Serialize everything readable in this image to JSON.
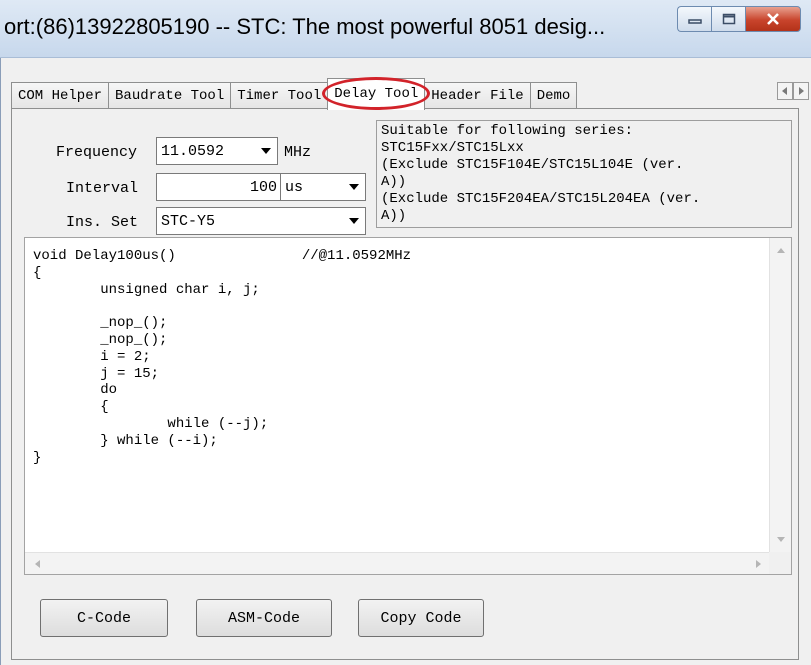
{
  "window": {
    "title": "ort:(86)13922805190  -- STC: The most powerful 8051 desig..."
  },
  "tabs": [
    {
      "label": "COM Helper"
    },
    {
      "label": "Baudrate Tool"
    },
    {
      "label": "Timer Tool"
    },
    {
      "label": "Delay Tool"
    },
    {
      "label": "Header File"
    },
    {
      "label": "Demo"
    }
  ],
  "active_tab": "Delay Tool",
  "highlight_color": "#d2232a",
  "settings": {
    "frequency_label": "Frequency",
    "frequency_value": "11.0592",
    "frequency_unit": "MHz",
    "interval_label": "Interval",
    "interval_value": "100",
    "interval_unit": "us",
    "ins_set_label": "Ins. Set",
    "ins_set_value": "STC-Y5"
  },
  "series_info": {
    "lines": [
      "Suitable for following series:",
      "STC15Fxx/STC15Lxx",
      " (Exclude STC15F104E/STC15L104E (ver.",
      "A))",
      " (Exclude STC15F204EA/STC15L204EA (ver.",
      "A))"
    ]
  },
  "code": {
    "lines": [
      "void Delay100us()\t\t//@11.0592MHz",
      "{",
      "\tunsigned char i, j;",
      "",
      "\t_nop_();",
      "\t_nop_();",
      "\ti = 2;",
      "\tj = 15;",
      "\tdo",
      "\t{",
      "\t\twhile (--j);",
      "\t} while (--i);",
      "}"
    ]
  },
  "buttons": {
    "c_code": "C-Code",
    "asm_code": "ASM-Code",
    "copy_code": "Copy Code"
  }
}
